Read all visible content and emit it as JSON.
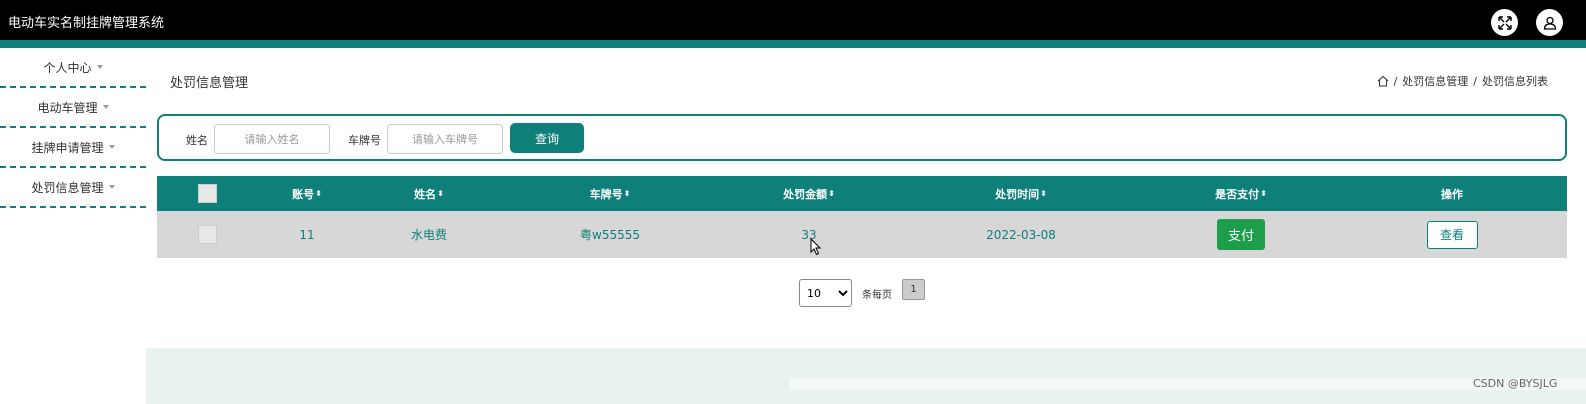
{
  "app": {
    "title": "电动车实名制挂牌管理系统"
  },
  "header_icons": [
    "fullscreen-icon",
    "user-icon"
  ],
  "sidebar": {
    "items": [
      {
        "label": "个人中心"
      },
      {
        "label": "电动车管理"
      },
      {
        "label": "挂牌申请管理"
      },
      {
        "label": "处罚信息管理"
      }
    ]
  },
  "page": {
    "title": "处罚信息管理",
    "breadcrumb": [
      "处罚信息管理",
      "处罚信息列表"
    ]
  },
  "search": {
    "name_label": "姓名",
    "name_placeholder": "请输入姓名",
    "plate_label": "车牌号",
    "plate_placeholder": "请输入车牌号",
    "query_label": "查询"
  },
  "table": {
    "columns": [
      "账号",
      "姓名",
      "车牌号",
      "处罚金额",
      "处罚时间",
      "是否支付",
      "操作"
    ],
    "rows": [
      {
        "account": "11",
        "name": "水电费",
        "plate": "粤w55555",
        "amount": "33",
        "time": "2022-03-08",
        "pay_label": "支付",
        "view_label": "查看"
      }
    ]
  },
  "pagination": {
    "page_size": "10",
    "per_page_label": "条每页",
    "current_page": "1"
  },
  "watermark": "CSDN @BYSJLG",
  "colors": {
    "accent": "#0e7f79",
    "pay": "#1e9e4b",
    "row_bg": "#d7d7d7"
  }
}
